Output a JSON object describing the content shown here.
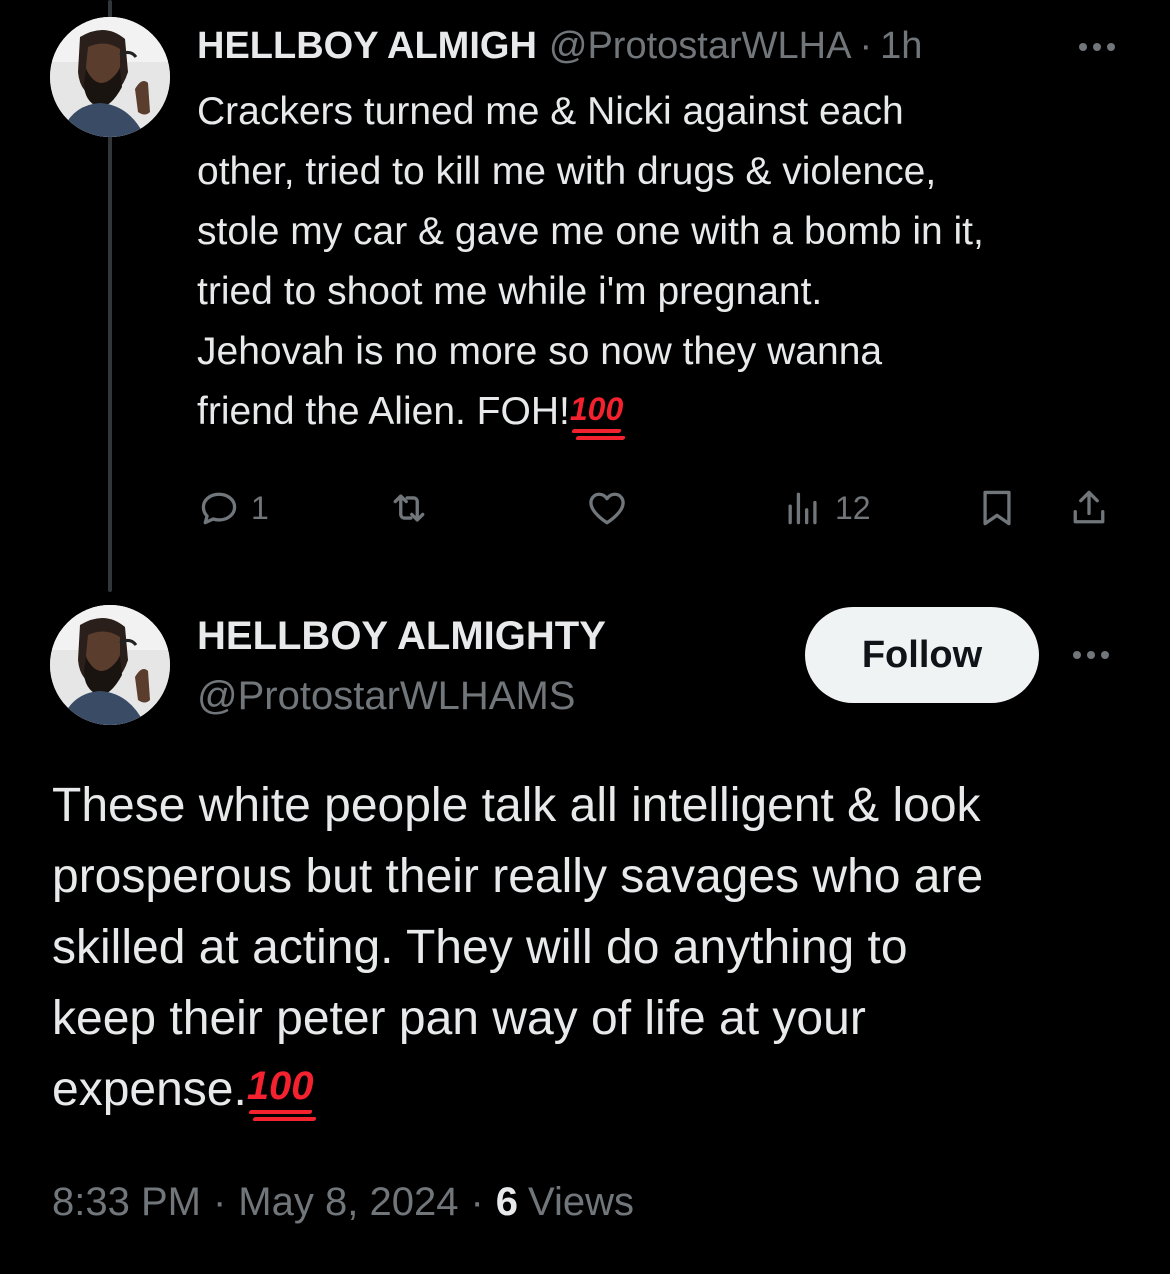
{
  "tweet1": {
    "display_name": "HELLBOY ALMIGH",
    "handle": "@ProtostarWLHA",
    "separator": "·",
    "time": "1h",
    "body_lines": [
      "Crackers turned me & Nicki against each",
      "other, tried to kill me with drugs & violence,",
      "stole my car & gave me one with a bomb in it,",
      "tried to shoot me while i'm pregnant.",
      "Jehovah is no more so now they wanna",
      "friend the Alien. FOH!"
    ],
    "emoji": "100",
    "actions": {
      "reply_count": "1",
      "repost_count": "",
      "like_count": "",
      "views_count": "12"
    }
  },
  "tweet2": {
    "display_name": "HELLBOY ALMIGHTY",
    "handle": "@ProtostarWLHAMS",
    "follow_label": "Follow",
    "body_lines": [
      "These white people talk all  intelligent & look",
      "prosperous but their really savages who are",
      "skilled at acting. They will do anything to",
      "keep their peter pan way of life at your",
      "expense."
    ],
    "emoji": "100",
    "time": "8:33 PM",
    "date": "May 8, 2024",
    "separator": "·",
    "views_count": "6",
    "views_label": "Views"
  },
  "icons": [
    "more-icon",
    "reply-icon",
    "repost-icon",
    "like-icon",
    "views-icon",
    "bookmark-icon",
    "share-icon"
  ],
  "colors": {
    "background": "#000000",
    "text_primary": "#e7e9ea",
    "text_secondary": "#71767b",
    "thread_line": "#333639",
    "follow_bg": "#eff3f4",
    "emoji_red": "#f4212e"
  }
}
